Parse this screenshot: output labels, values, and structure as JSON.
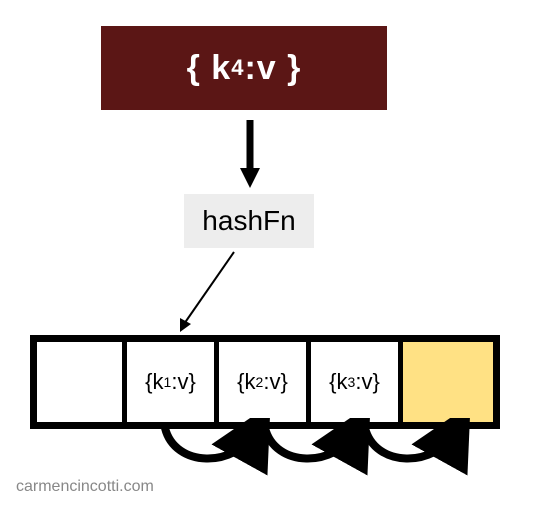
{
  "input": {
    "open": "{",
    "key_prefix": "k",
    "key_sub": "4",
    "sep": ": ",
    "value": "v",
    "close": "}"
  },
  "hashfn": {
    "label": "hashFn"
  },
  "array": {
    "cells": [
      {
        "open": "",
        "k": "",
        "sub": "",
        "sep": "",
        "v": "",
        "close": ""
      },
      {
        "open": "{",
        "k": "k",
        "sub": "1",
        "sep": ":",
        "v": "v",
        "close": "}"
      },
      {
        "open": "{",
        "k": "k",
        "sub": "2",
        "sep": ":",
        "v": "v",
        "close": "}"
      },
      {
        "open": "{",
        "k": "k",
        "sub": "3",
        "sep": ":",
        "v": "v",
        "close": "}"
      },
      {
        "open": "",
        "k": "",
        "sub": "",
        "sep": "",
        "v": "",
        "close": ""
      }
    ]
  },
  "attribution": "carmencincotti.com",
  "colors": {
    "input_bg": "#5b1615",
    "highlight": "#ffe184"
  }
}
